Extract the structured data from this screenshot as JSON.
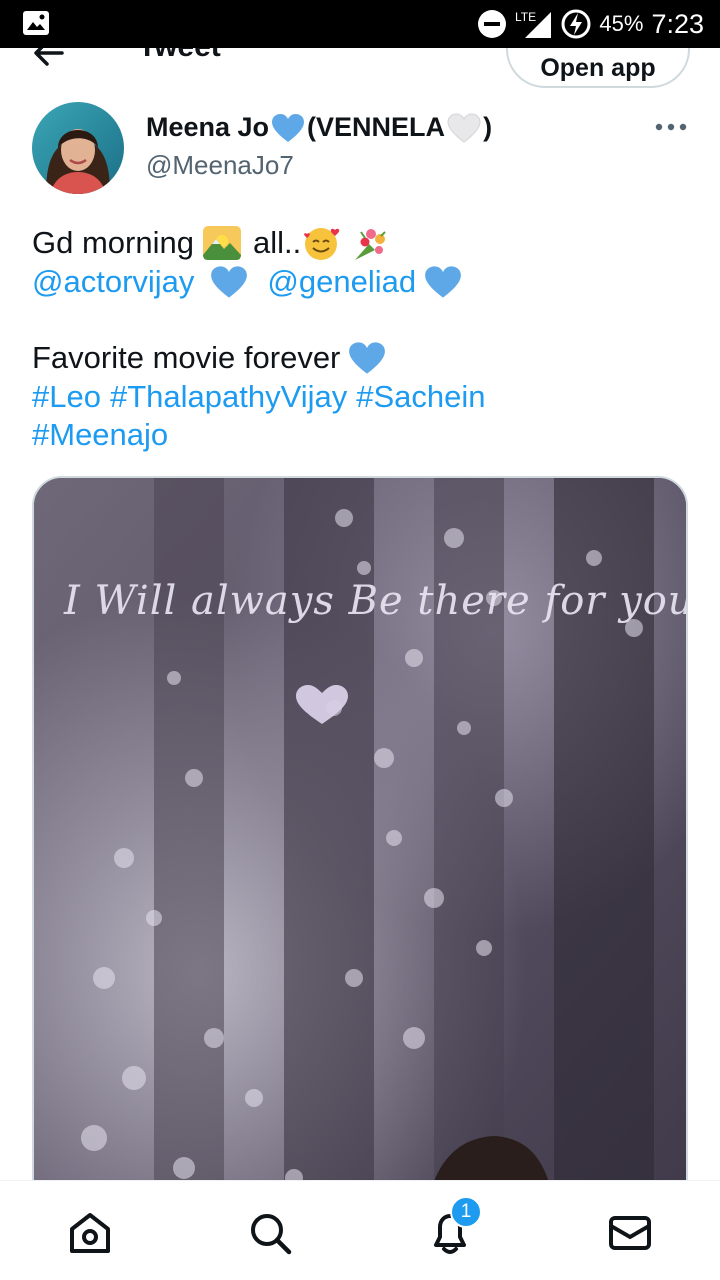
{
  "status_bar": {
    "network": "LTE",
    "battery": "45%",
    "time": "7:23",
    "icons": [
      "image-icon",
      "dnd-icon",
      "signal-icon",
      "battery-charging-icon"
    ]
  },
  "nav": {
    "title": "Tweet",
    "open_app_label": "Open app",
    "back_icon": "back-arrow-icon"
  },
  "tweet": {
    "author": {
      "name_part1": "Meena Jo",
      "name_part2": "(VENNELA",
      "name_part3": ")",
      "handle": "@MeenaJo7"
    },
    "lines": {
      "l1_text_a": "Gd morning",
      "l1_text_b": "all..",
      "l2_mention1": "@actorvijay",
      "l2_mention2": "@geneliad",
      "l3_text": "Favorite movie forever",
      "l4_tag1": "#Leo",
      "l4_tag2": "#ThalapathyVijay",
      "l4_tag3": "#Sachein",
      "l5_tag1": "#Meenajo"
    },
    "media_caption": "I Will always Be there for you.."
  },
  "bottom_nav": {
    "items": [
      "home-icon",
      "search-icon",
      "notifications-icon",
      "messages-icon"
    ],
    "notification_count": "1"
  },
  "colors": {
    "link": "#1d9bf0",
    "heart_blue": "#5ea8e8",
    "text": "#0f1419",
    "secondary": "#536471"
  }
}
